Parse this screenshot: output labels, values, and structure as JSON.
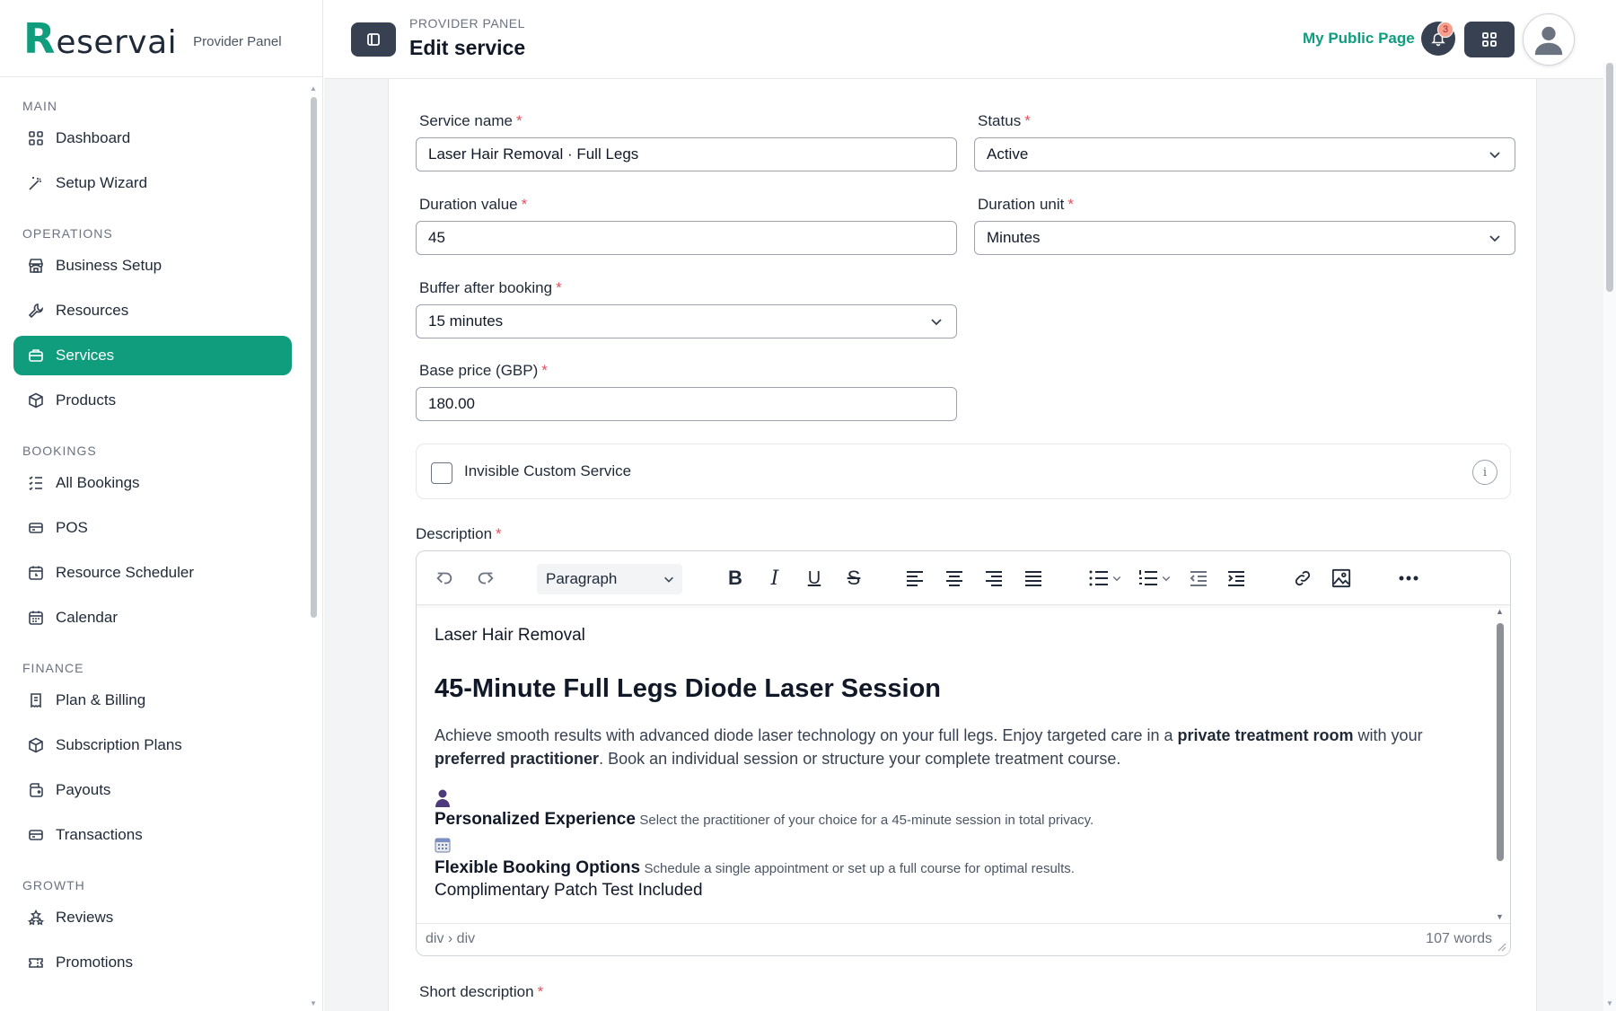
{
  "brand": {
    "logo_r": "R",
    "logo_rest": "eservai",
    "subtitle": "Provider Panel"
  },
  "sidebar": {
    "sections": [
      {
        "title": "MAIN",
        "items": [
          {
            "label": "Dashboard",
            "icon": "dashboard-icon"
          },
          {
            "label": "Setup Wizard",
            "icon": "wand-icon"
          }
        ]
      },
      {
        "title": "OPERATIONS",
        "items": [
          {
            "label": "Business Setup",
            "icon": "store-icon"
          },
          {
            "label": "Resources",
            "icon": "wrench-icon"
          },
          {
            "label": "Services",
            "icon": "briefcase-icon",
            "active": true
          },
          {
            "label": "Products",
            "icon": "box-icon"
          }
        ]
      },
      {
        "title": "BOOKINGS",
        "items": [
          {
            "label": "All Bookings",
            "icon": "list-icon"
          },
          {
            "label": "POS",
            "icon": "card-icon"
          },
          {
            "label": "Resource Scheduler",
            "icon": "calendar-clock-icon"
          },
          {
            "label": "Calendar",
            "icon": "calendar-icon"
          }
        ]
      },
      {
        "title": "FINANCE",
        "items": [
          {
            "label": "Plan & Billing",
            "icon": "receipt-icon"
          },
          {
            "label": "Subscription Plans",
            "icon": "box-icon"
          },
          {
            "label": "Payouts",
            "icon": "wallet-icon"
          },
          {
            "label": "Transactions",
            "icon": "card-icon"
          }
        ]
      },
      {
        "title": "GROWTH",
        "items": [
          {
            "label": "Reviews",
            "icon": "stars-icon"
          },
          {
            "label": "Promotions",
            "icon": "ticket-icon"
          }
        ]
      }
    ]
  },
  "header": {
    "breadcrumb": "PROVIDER PANEL",
    "title": "Edit service",
    "public_link": "My Public Page",
    "notifications": "3"
  },
  "form": {
    "service_name": {
      "label": "Service name",
      "value": "Laser Hair Removal · Full Legs"
    },
    "status": {
      "label": "Status",
      "value": "Active"
    },
    "duration_value": {
      "label": "Duration value",
      "value": "45"
    },
    "duration_unit": {
      "label": "Duration unit",
      "value": "Minutes"
    },
    "buffer": {
      "label": "Buffer after booking",
      "value": "15 minutes"
    },
    "base_price": {
      "label": "Base price (GBP)",
      "value": "180.00"
    },
    "invisible": {
      "label": "Invisible Custom Service"
    },
    "description": {
      "label": "Description"
    },
    "short_description": {
      "label": "Short description"
    },
    "required_mark": "*"
  },
  "editor": {
    "block_format": "Paragraph",
    "content": {
      "eyebrow": "Laser Hair Removal",
      "heading": "45-Minute Full Legs Diode Laser Session",
      "lead_1": "Achieve smooth results with advanced diode laser technology on your full legs. Enjoy targeted care in a ",
      "lead_bold_1": "private treatment room",
      "lead_2": " with your ",
      "lead_bold_2": "preferred practitioner",
      "lead_3": ". Book an individual session or structure your complete treatment course.",
      "feature_1_title": "Personalized Experience",
      "feature_1_desc": "Select the practitioner of your choice for a 45-minute session in total privacy.",
      "feature_2_title": "Flexible Booking Options",
      "feature_2_desc": "Schedule a single appointment or set up a full course for optimal results.",
      "last_line": "Complimentary Patch Test Included"
    },
    "path": "div › div",
    "word_count": "107 words"
  },
  "colors": {
    "accent": "#0f9d7e",
    "dark_button": "#374151",
    "required": "#e05260"
  }
}
